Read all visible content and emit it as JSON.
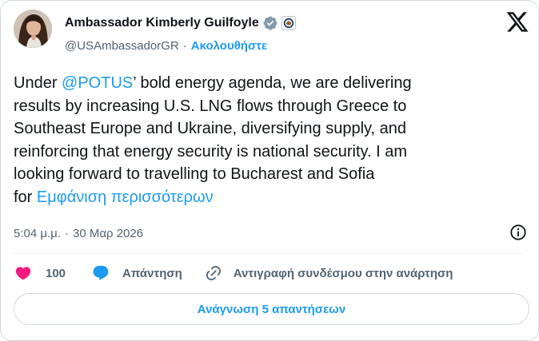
{
  "author": {
    "display_name": "Ambassador Kimberly Guilfoyle",
    "handle": "@USAmbassadorGR",
    "separator": "·",
    "follow_label": "Ακολουθήστε",
    "verified_icon": "verified-badge-icon",
    "affiliation_icon": "government-seal-icon",
    "avatar_icon": "profile-photo"
  },
  "tweet": {
    "line1_prefix": "Under ",
    "mention": "@POTUS",
    "line1_suffix": "’ bold energy agenda, we are delivering",
    "line2": "results by increasing U.S. LNG flows through Greece to",
    "line3": "Southeast Europe and Ukraine, diversifying supply, and",
    "line4": "reinforcing that energy security is national security. I am",
    "line5": "looking forward to travelling to Bucharest and Sofia",
    "line6_prefix": "for ",
    "show_more": "Εμφάνιση περισσότερων"
  },
  "meta": {
    "time": "5:04 μ.μ.",
    "separator": "·",
    "date": "30 Μαρ 2026"
  },
  "actions": {
    "like_count": "100",
    "reply_label": "Απάντηση",
    "copy_link_label": "Αντιγραφή συνδέσμου στην ανάρτηση"
  },
  "read_replies_label": "Ανάγνωση 5 απαντήσεων",
  "colors": {
    "accent": "#1d9bf0",
    "like": "#f91880",
    "text": "#0f1419",
    "secondary": "#536471",
    "verified": "#829aab"
  }
}
